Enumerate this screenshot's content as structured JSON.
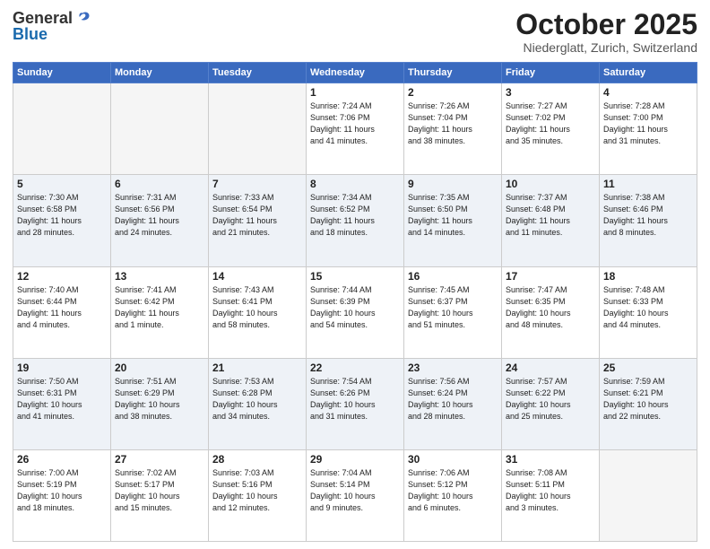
{
  "header": {
    "logo_general": "General",
    "logo_blue": "Blue",
    "month": "October 2025",
    "location": "Niederglatt, Zurich, Switzerland"
  },
  "weekdays": [
    "Sunday",
    "Monday",
    "Tuesday",
    "Wednesday",
    "Thursday",
    "Friday",
    "Saturday"
  ],
  "weeks": [
    [
      {
        "day": "",
        "info": ""
      },
      {
        "day": "",
        "info": ""
      },
      {
        "day": "",
        "info": ""
      },
      {
        "day": "1",
        "info": "Sunrise: 7:24 AM\nSunset: 7:06 PM\nDaylight: 11 hours\nand 41 minutes."
      },
      {
        "day": "2",
        "info": "Sunrise: 7:26 AM\nSunset: 7:04 PM\nDaylight: 11 hours\nand 38 minutes."
      },
      {
        "day": "3",
        "info": "Sunrise: 7:27 AM\nSunset: 7:02 PM\nDaylight: 11 hours\nand 35 minutes."
      },
      {
        "day": "4",
        "info": "Sunrise: 7:28 AM\nSunset: 7:00 PM\nDaylight: 11 hours\nand 31 minutes."
      }
    ],
    [
      {
        "day": "5",
        "info": "Sunrise: 7:30 AM\nSunset: 6:58 PM\nDaylight: 11 hours\nand 28 minutes."
      },
      {
        "day": "6",
        "info": "Sunrise: 7:31 AM\nSunset: 6:56 PM\nDaylight: 11 hours\nand 24 minutes."
      },
      {
        "day": "7",
        "info": "Sunrise: 7:33 AM\nSunset: 6:54 PM\nDaylight: 11 hours\nand 21 minutes."
      },
      {
        "day": "8",
        "info": "Sunrise: 7:34 AM\nSunset: 6:52 PM\nDaylight: 11 hours\nand 18 minutes."
      },
      {
        "day": "9",
        "info": "Sunrise: 7:35 AM\nSunset: 6:50 PM\nDaylight: 11 hours\nand 14 minutes."
      },
      {
        "day": "10",
        "info": "Sunrise: 7:37 AM\nSunset: 6:48 PM\nDaylight: 11 hours\nand 11 minutes."
      },
      {
        "day": "11",
        "info": "Sunrise: 7:38 AM\nSunset: 6:46 PM\nDaylight: 11 hours\nand 8 minutes."
      }
    ],
    [
      {
        "day": "12",
        "info": "Sunrise: 7:40 AM\nSunset: 6:44 PM\nDaylight: 11 hours\nand 4 minutes."
      },
      {
        "day": "13",
        "info": "Sunrise: 7:41 AM\nSunset: 6:42 PM\nDaylight: 11 hours\nand 1 minute."
      },
      {
        "day": "14",
        "info": "Sunrise: 7:43 AM\nSunset: 6:41 PM\nDaylight: 10 hours\nand 58 minutes."
      },
      {
        "day": "15",
        "info": "Sunrise: 7:44 AM\nSunset: 6:39 PM\nDaylight: 10 hours\nand 54 minutes."
      },
      {
        "day": "16",
        "info": "Sunrise: 7:45 AM\nSunset: 6:37 PM\nDaylight: 10 hours\nand 51 minutes."
      },
      {
        "day": "17",
        "info": "Sunrise: 7:47 AM\nSunset: 6:35 PM\nDaylight: 10 hours\nand 48 minutes."
      },
      {
        "day": "18",
        "info": "Sunrise: 7:48 AM\nSunset: 6:33 PM\nDaylight: 10 hours\nand 44 minutes."
      }
    ],
    [
      {
        "day": "19",
        "info": "Sunrise: 7:50 AM\nSunset: 6:31 PM\nDaylight: 10 hours\nand 41 minutes."
      },
      {
        "day": "20",
        "info": "Sunrise: 7:51 AM\nSunset: 6:29 PM\nDaylight: 10 hours\nand 38 minutes."
      },
      {
        "day": "21",
        "info": "Sunrise: 7:53 AM\nSunset: 6:28 PM\nDaylight: 10 hours\nand 34 minutes."
      },
      {
        "day": "22",
        "info": "Sunrise: 7:54 AM\nSunset: 6:26 PM\nDaylight: 10 hours\nand 31 minutes."
      },
      {
        "day": "23",
        "info": "Sunrise: 7:56 AM\nSunset: 6:24 PM\nDaylight: 10 hours\nand 28 minutes."
      },
      {
        "day": "24",
        "info": "Sunrise: 7:57 AM\nSunset: 6:22 PM\nDaylight: 10 hours\nand 25 minutes."
      },
      {
        "day": "25",
        "info": "Sunrise: 7:59 AM\nSunset: 6:21 PM\nDaylight: 10 hours\nand 22 minutes."
      }
    ],
    [
      {
        "day": "26",
        "info": "Sunrise: 7:00 AM\nSunset: 5:19 PM\nDaylight: 10 hours\nand 18 minutes."
      },
      {
        "day": "27",
        "info": "Sunrise: 7:02 AM\nSunset: 5:17 PM\nDaylight: 10 hours\nand 15 minutes."
      },
      {
        "day": "28",
        "info": "Sunrise: 7:03 AM\nSunset: 5:16 PM\nDaylight: 10 hours\nand 12 minutes."
      },
      {
        "day": "29",
        "info": "Sunrise: 7:04 AM\nSunset: 5:14 PM\nDaylight: 10 hours\nand 9 minutes."
      },
      {
        "day": "30",
        "info": "Sunrise: 7:06 AM\nSunset: 5:12 PM\nDaylight: 10 hours\nand 6 minutes."
      },
      {
        "day": "31",
        "info": "Sunrise: 7:08 AM\nSunset: 5:11 PM\nDaylight: 10 hours\nand 3 minutes."
      },
      {
        "day": "",
        "info": ""
      }
    ]
  ]
}
